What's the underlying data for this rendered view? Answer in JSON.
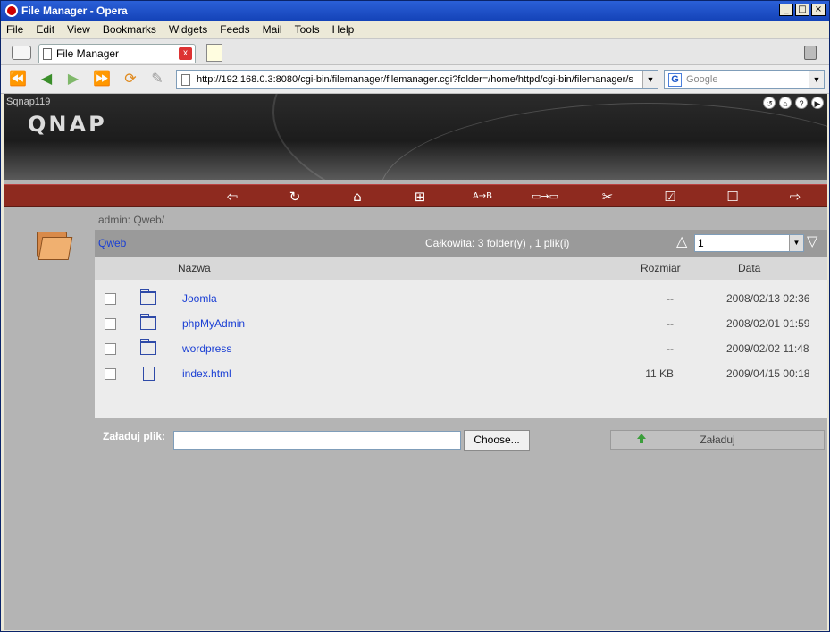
{
  "window": {
    "title": "File Manager - Opera"
  },
  "menu": [
    "File",
    "Edit",
    "View",
    "Bookmarks",
    "Widgets",
    "Feeds",
    "Mail",
    "Tools",
    "Help"
  ],
  "tab": {
    "label": "File Manager"
  },
  "address": {
    "url": "http://192.168.0.3:8080/cgi-bin/filemanager/filemanager.cgi?folder=/home/httpd/cgi-bin/filemanager/s"
  },
  "search": {
    "placeholder": "Google"
  },
  "header": {
    "host": "Sqnap119",
    "logo": "QNAP"
  },
  "breadcrumb": "admin: Qweb/",
  "panel": {
    "folder": "Qweb",
    "total": "Całkowita: 3 folder(y) , 1 plik(i)",
    "page": "1"
  },
  "columns": {
    "name": "Nazwa",
    "size": "Rozmiar",
    "date": "Data"
  },
  "files": [
    {
      "type": "folder",
      "name": "Joomla",
      "size": "--",
      "date": "2008/02/13 02:36"
    },
    {
      "type": "folder",
      "name": "phpMyAdmin",
      "size": "--",
      "date": "2008/02/01 01:59"
    },
    {
      "type": "folder",
      "name": "wordpress",
      "size": "--",
      "date": "2009/02/02 11:48"
    },
    {
      "type": "file",
      "name": "index.html",
      "size": "11 KB",
      "date": "2009/04/15 00:18"
    }
  ],
  "upload": {
    "label": "Załaduj plik:",
    "choose": "Choose...",
    "button": "Załaduj"
  }
}
